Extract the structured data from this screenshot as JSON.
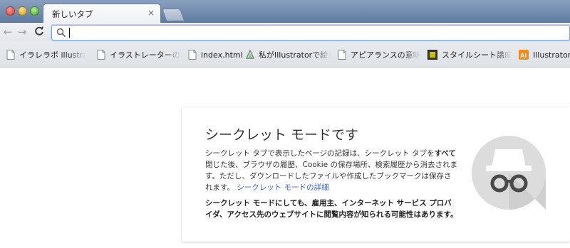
{
  "window": {
    "tab_title": "新しいタブ",
    "tab_close_glyph": "×"
  },
  "toolbar": {
    "back_glyph": "←",
    "forward_glyph": "→",
    "reload_glyph": "C",
    "omnibox_value": ""
  },
  "bookmarks": [
    {
      "icon": "page-icon",
      "label": "イラレラボ illustrator"
    },
    {
      "icon": "page-icon",
      "label": "イラストレーターのバ"
    },
    {
      "icon": "page-icon",
      "label": "index.html"
    },
    {
      "icon": "triangle-logo-icon",
      "label": "私がIllustratorで絵を"
    },
    {
      "icon": "page-icon",
      "label": "アピアランスの意味と"
    },
    {
      "icon": "stylesheet-icon",
      "label": "スタイルシート講座"
    },
    {
      "icon": "ai-icon",
      "label": "Illustratorで"
    }
  ],
  "incognito": {
    "title": "シークレット モードです",
    "para1_a": "シークレット タブで表示したページの記録は、シークレット タブを",
    "para1_bold": "すべて",
    "para1_b": "閉じた後、ブラウザの履歴、Cookie の保存場所、検索履歴から消去されます。ただし、ダウンロードしたファイルや作成したブックマークは保存されます。",
    "link": "シークレット モードの詳細",
    "warning": "シークレット モードにしても、雇用主、インターネット サービス プロバイダ、アクセス先のウェブサイトに閲覧内容が知られる可能性はあります。"
  },
  "colors": {
    "link": "#3366cc",
    "titlebar": "#6f88ad"
  }
}
